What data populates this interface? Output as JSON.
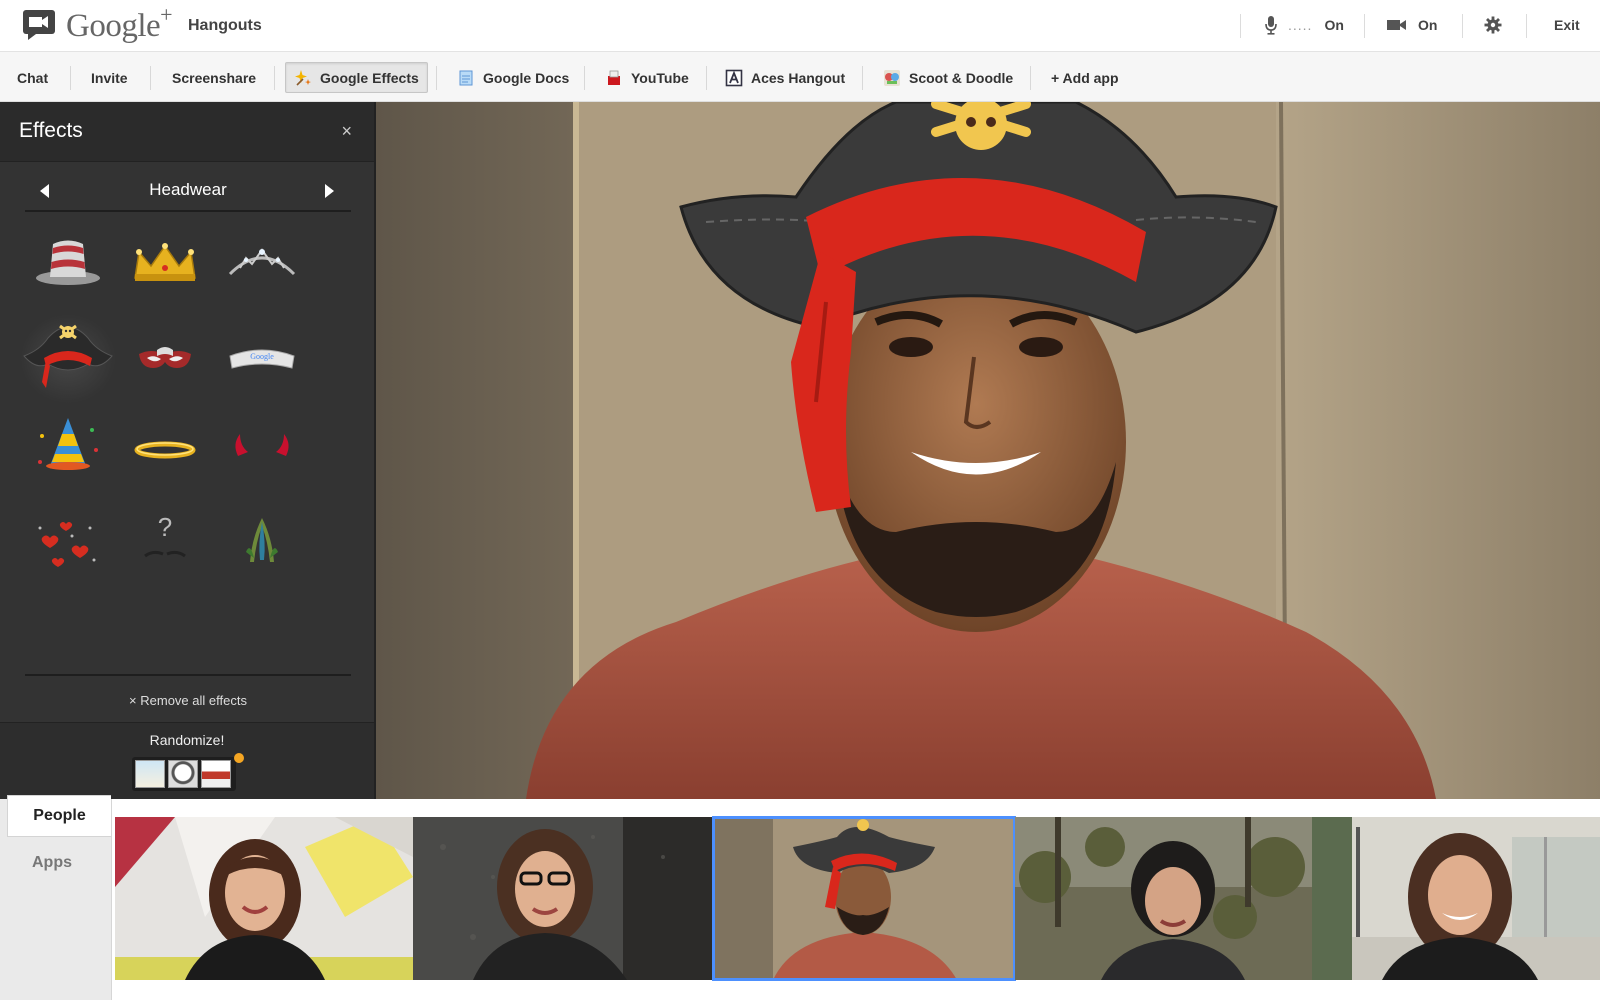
{
  "topbar": {
    "brand": "Google",
    "brand_plus": "+",
    "product": "Hangouts",
    "mic_dots": ".....",
    "mic_status": "On",
    "camera_status": "On",
    "exit_label": "Exit",
    "icons": [
      "hangouts-logo-icon",
      "microphone-icon",
      "video-camera-icon",
      "gear-icon"
    ]
  },
  "appbar": {
    "tabs": [
      {
        "label": "Chat"
      },
      {
        "label": "Invite"
      },
      {
        "label": "Screenshare"
      },
      {
        "label": "Google Effects",
        "active": true,
        "icon": "sparkle-icon"
      },
      {
        "label": "Google Docs",
        "icon": "docs-icon"
      },
      {
        "label": "YouTube",
        "icon": "youtube-icon"
      },
      {
        "label": "Aces Hangout",
        "icon": "aces-icon"
      },
      {
        "label": "Scoot & Doodle",
        "icon": "scoot-doodle-icon"
      },
      {
        "label": "+ Add app"
      }
    ]
  },
  "effects": {
    "title": "Effects",
    "close": "×",
    "category": "Headwear",
    "items": [
      {
        "name": "top-hat-icon"
      },
      {
        "name": "crown-icon"
      },
      {
        "name": "tiara-icon"
      },
      {
        "name": "pirate-hat-icon",
        "selected": true
      },
      {
        "name": "mask-icon"
      },
      {
        "name": "google-visor-icon"
      },
      {
        "name": "party-hat-icon"
      },
      {
        "name": "halo-icon"
      },
      {
        "name": "devil-horns-icon"
      },
      {
        "name": "hearts-icon"
      },
      {
        "name": "mystery-mustache-icon"
      },
      {
        "name": "feather-headdress-icon"
      }
    ],
    "remove_all": "× Remove all effects",
    "randomize_label": "Randomize!"
  },
  "bottom": {
    "tabs": [
      {
        "label": "People",
        "active": true
      },
      {
        "label": "Apps",
        "active": false
      }
    ],
    "participants": [
      {
        "name": "participant-1"
      },
      {
        "name": "participant-2"
      },
      {
        "name": "participant-3",
        "selected": true
      },
      {
        "name": "participant-4"
      },
      {
        "name": "participant-5"
      }
    ]
  },
  "colors": {
    "selected_outline": "#4d90fe",
    "panel_bg": "#333333",
    "pirate_bandana": "#d9271c",
    "randomize_dot": "#f5a623"
  }
}
